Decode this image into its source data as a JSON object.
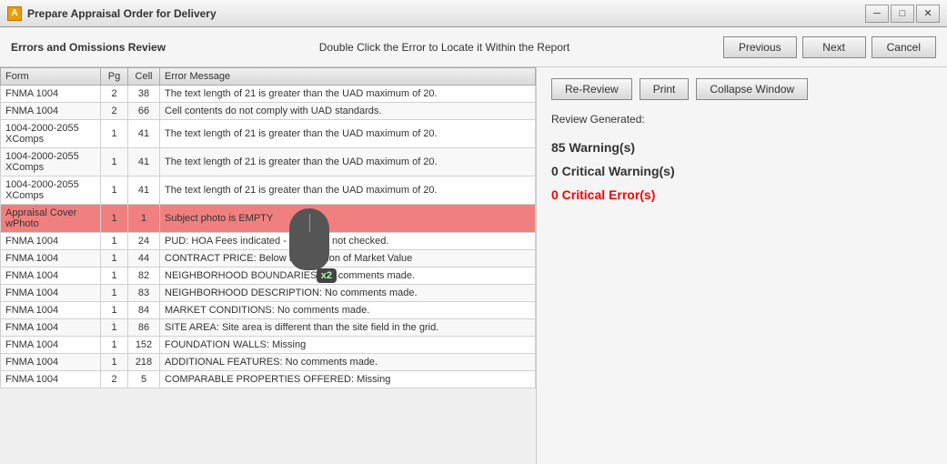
{
  "titleBar": {
    "icon": "A",
    "title": "Prepare Appraisal Order for Delivery",
    "minBtn": "─",
    "maxBtn": "□",
    "closeBtn": "✕"
  },
  "toolbar": {
    "leftLabel": "Errors and Omissions Review",
    "centerLabel": "Double Click the Error to Locate it Within the Report",
    "previousLabel": "Previous",
    "nextLabel": "Next",
    "cancelLabel": "Cancel"
  },
  "panel": {
    "reReviewLabel": "Re-Review",
    "printLabel": "Print",
    "collapseWindowLabel": "Collapse Window",
    "reviewGenerated": "Review Generated:",
    "warningsCount": "85 Warning(s)",
    "criticalWarnings": "0 Critical Warning(s)",
    "criticalErrors": "0 Critical Error(s)"
  },
  "table": {
    "headers": [
      "Form",
      "Pg",
      "Cell",
      "Error Message"
    ],
    "rows": [
      {
        "form": "FNMA 1004",
        "pg": "2",
        "cell": "38",
        "msg": "The text length of 21 is greater than the UAD maximum of 20.",
        "selected": false
      },
      {
        "form": "FNMA 1004",
        "pg": "2",
        "cell": "66",
        "msg": "Cell contents do not comply with UAD standards.",
        "selected": false
      },
      {
        "form": "1004-2000-2055\nXComps",
        "pg": "1",
        "cell": "41",
        "msg": "The text length of 21 is greater than the UAD maximum of 20.",
        "selected": false
      },
      {
        "form": "1004-2000-2055\nXComps",
        "pg": "1",
        "cell": "41",
        "msg": "The text length of 21 is greater than the UAD maximum of 20.",
        "selected": false
      },
      {
        "form": "1004-2000-2055\nXComps",
        "pg": "1",
        "cell": "41",
        "msg": "The text length of 21 is greater than the UAD maximum of 20.",
        "selected": false
      },
      {
        "form": "Appraisal Cover wPhoto",
        "pg": "1",
        "cell": "1",
        "msg": "Subject photo is EMPTY",
        "selected": true
      },
      {
        "form": "FNMA 1004",
        "pg": "1",
        "cell": "24",
        "msg": "PUD: HOA Fees indicated - PUD box not checked.",
        "selected": false
      },
      {
        "form": "FNMA 1004",
        "pg": "1",
        "cell": "44",
        "msg": "CONTRACT PRICE: Below the Opinion of Market Value",
        "selected": false
      },
      {
        "form": "FNMA 1004",
        "pg": "1",
        "cell": "82",
        "msg": "NEIGHBORHOOD BOUNDARIES: No comments made.",
        "selected": false
      },
      {
        "form": "FNMA 1004",
        "pg": "1",
        "cell": "83",
        "msg": "NEIGHBORHOOD DESCRIPTION: No comments made.",
        "selected": false
      },
      {
        "form": "FNMA 1004",
        "pg": "1",
        "cell": "84",
        "msg": "MARKET CONDITIONS: No comments made.",
        "selected": false
      },
      {
        "form": "FNMA 1004",
        "pg": "1",
        "cell": "86",
        "msg": "SITE AREA: Site area is different than the site field in the grid.",
        "selected": false
      },
      {
        "form": "FNMA 1004",
        "pg": "1",
        "cell": "152",
        "msg": "FOUNDATION WALLS: Missing",
        "selected": false
      },
      {
        "form": "FNMA 1004",
        "pg": "1",
        "cell": "218",
        "msg": "ADDITIONAL FEATURES: No comments made.",
        "selected": false
      },
      {
        "form": "FNMA 1004",
        "pg": "2",
        "cell": "5",
        "msg": "COMPARABLE PROPERTIES OFFERED: Missing",
        "selected": false
      }
    ]
  }
}
